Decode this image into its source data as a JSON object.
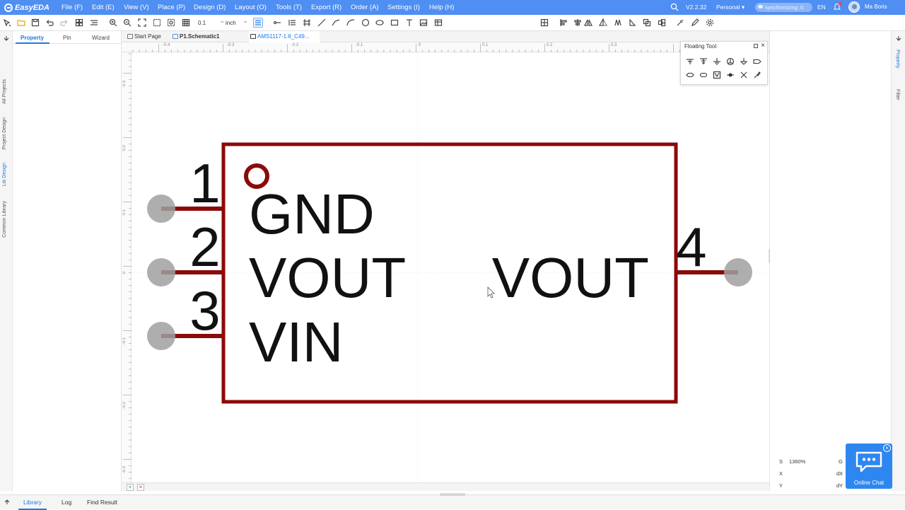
{
  "app": {
    "name": "EasyEDA",
    "version": "V2.2.32",
    "account": "Personal",
    "sync_status": "synchronizing: 0",
    "language": "EN",
    "user": "Ma Boris"
  },
  "menu": [
    {
      "label": "File (F)"
    },
    {
      "label": "Edit (E)"
    },
    {
      "label": "View (V)"
    },
    {
      "label": "Place (P)"
    },
    {
      "label": "Design (D)"
    },
    {
      "label": "Layout (O)"
    },
    {
      "label": "Tools (T)"
    },
    {
      "label": "Export (R)"
    },
    {
      "label": "Order (A)"
    },
    {
      "label": "Settings (I)"
    },
    {
      "label": "Help (H)"
    }
  ],
  "toolbar": {
    "grid_size": "0.1",
    "unit": "inch",
    "icons": [
      "select-icon",
      "folder-icon",
      "save-icon",
      "undo-icon",
      "redo-icon",
      "group-icon",
      "align-icon",
      "zoom-in-icon",
      "zoom-out-icon",
      "fit-icon",
      "zoom-area-icon",
      "zoom-selection-icon",
      "grid-icon",
      "pin-icon",
      "bus-icon",
      "pin-array-icon",
      "line-icon",
      "polyline-icon",
      "arc-icon",
      "circle-icon",
      "ellipse-icon",
      "rectangle-icon",
      "text-icon",
      "image-icon",
      "table-icon",
      "attribute-icon",
      "align-left-icon",
      "align-center-icon",
      "align-right-icon",
      "mirror-icon",
      "copy-icon",
      "layers-icon",
      "snap-icon",
      "settings-icon"
    ]
  },
  "left_vtabs": [
    "All Projects",
    "Project Design",
    "Lib Design",
    "Common Library"
  ],
  "left_vtab_active": "Lib Design",
  "left_panel": {
    "tabs": [
      "Property",
      "Pin",
      "Wizard"
    ],
    "active": "Property"
  },
  "doc_tabs": [
    {
      "label": "Start Page"
    },
    {
      "label": "P1.Schematic1"
    },
    {
      "label": "AMS1117-1.8_C49..."
    }
  ],
  "ruler": {
    "top": [
      "-0.4",
      "-0.3",
      "-0.2",
      "-0.1",
      "0",
      "0.1",
      "0.2",
      "0.3"
    ],
    "left": [
      "0.3",
      "0.2",
      "0.1",
      "0",
      "-0.1",
      "-0.2",
      "-0.3"
    ]
  },
  "symbol": {
    "pins": [
      {
        "number": "1",
        "name": "GND"
      },
      {
        "number": "2",
        "name": "VOUT"
      },
      {
        "number": "3",
        "name": "VIN"
      },
      {
        "number": "4",
        "name": "VOUT"
      }
    ],
    "body_color": "#8b0a0a",
    "pin_dot_color": "#a0a0a0"
  },
  "floating_tool": {
    "title": "Floating Tool",
    "icons": [
      "net-port-icon",
      "net-flag-icon",
      "ground-icon",
      "power-icon",
      "gnd-arrow-icon",
      "input-port-icon",
      "output-port-icon",
      "bidirectional-port-icon",
      "no-connect-icon",
      "junction-icon",
      "cross-icon",
      "pen-icon"
    ]
  },
  "right_vtabs": [
    "Property",
    "Filter"
  ],
  "coords": {
    "s_label": "S",
    "s_value": "1360%",
    "x_label": "X",
    "y_label": "Y",
    "g_label": "G",
    "dx_label": "dX",
    "dy_label": "dY"
  },
  "online_chat": {
    "label": "Online Chat"
  },
  "status_tabs": [
    "Library",
    "Log",
    "Find Result"
  ],
  "status_active": "Library"
}
